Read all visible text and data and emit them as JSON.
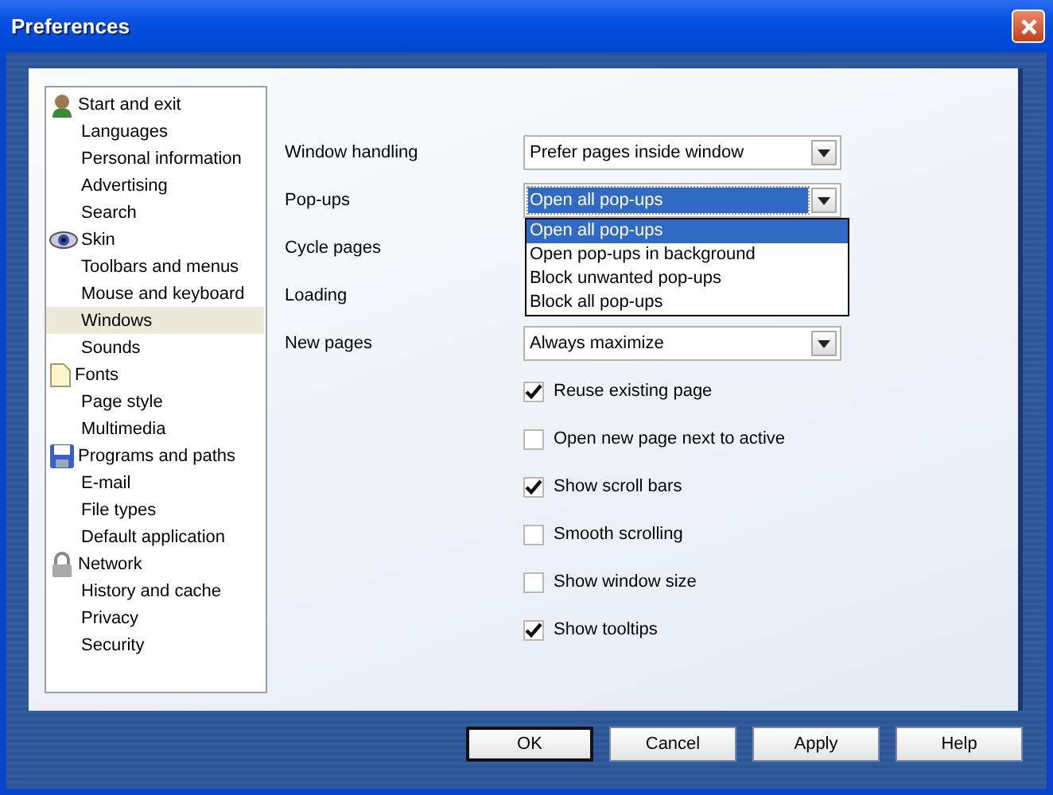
{
  "window": {
    "title": "Preferences"
  },
  "sidebar": {
    "items": [
      {
        "label": "Start and exit",
        "kind": "group",
        "selected": false
      },
      {
        "label": "Languages",
        "kind": "page",
        "selected": false
      },
      {
        "label": "Personal information",
        "kind": "page",
        "selected": false
      },
      {
        "label": "Advertising",
        "kind": "page",
        "selected": false
      },
      {
        "label": "Search",
        "kind": "page",
        "selected": false
      },
      {
        "label": "Skin",
        "kind": "group",
        "selected": false
      },
      {
        "label": "Toolbars and menus",
        "kind": "page",
        "selected": false
      },
      {
        "label": "Mouse and keyboard",
        "kind": "page",
        "selected": false
      },
      {
        "label": "Windows",
        "kind": "page",
        "selected": true
      },
      {
        "label": "Sounds",
        "kind": "page",
        "selected": false
      },
      {
        "label": "Fonts",
        "kind": "group",
        "selected": false
      },
      {
        "label": "Page style",
        "kind": "page",
        "selected": false
      },
      {
        "label": "Multimedia",
        "kind": "page",
        "selected": false
      },
      {
        "label": "Programs and paths",
        "kind": "group",
        "selected": false
      },
      {
        "label": "E-mail",
        "kind": "page",
        "selected": false
      },
      {
        "label": "File types",
        "kind": "page",
        "selected": false
      },
      {
        "label": "Default application",
        "kind": "page",
        "selected": false
      },
      {
        "label": "Network",
        "kind": "group",
        "selected": false
      },
      {
        "label": "History and cache",
        "kind": "page",
        "selected": false
      },
      {
        "label": "Privacy",
        "kind": "page",
        "selected": false
      },
      {
        "label": "Security",
        "kind": "page",
        "selected": false
      }
    ]
  },
  "settings": [
    {
      "kind": "select",
      "label": "Window handling",
      "value": "Prefer pages inside window",
      "expanded": false
    },
    {
      "kind": "select",
      "label": "Pop-ups",
      "value": "Open all pop-ups",
      "expanded": true,
      "options": [
        {
          "label": "Open all pop-ups",
          "selected": true
        },
        {
          "label": "Open pop-ups in background",
          "selected": false
        },
        {
          "label": "Block unwanted pop-ups",
          "selected": false
        },
        {
          "label": "Block all pop-ups",
          "selected": false
        }
      ]
    },
    {
      "kind": "label",
      "label": "Cycle pages"
    },
    {
      "kind": "label",
      "label": "Loading"
    },
    {
      "kind": "select",
      "label": "New pages",
      "value": "Always maximize",
      "expanded": false
    },
    {
      "kind": "checkbox",
      "label": "Reuse existing page",
      "checked": true
    },
    {
      "kind": "checkbox",
      "label": "Open new page next to active",
      "checked": false
    },
    {
      "kind": "checkbox",
      "label": "Show scroll bars",
      "checked": true
    },
    {
      "kind": "checkbox",
      "label": "Smooth scrolling",
      "checked": false
    },
    {
      "kind": "checkbox",
      "label": "Show window size",
      "checked": false
    },
    {
      "kind": "checkbox",
      "label": "Show tooltips",
      "checked": true
    }
  ],
  "buttons": [
    {
      "label": "OK",
      "default": true
    },
    {
      "label": "Cancel",
      "default": false
    },
    {
      "label": "Apply",
      "default": false
    },
    {
      "label": "Help",
      "default": false
    }
  ]
}
